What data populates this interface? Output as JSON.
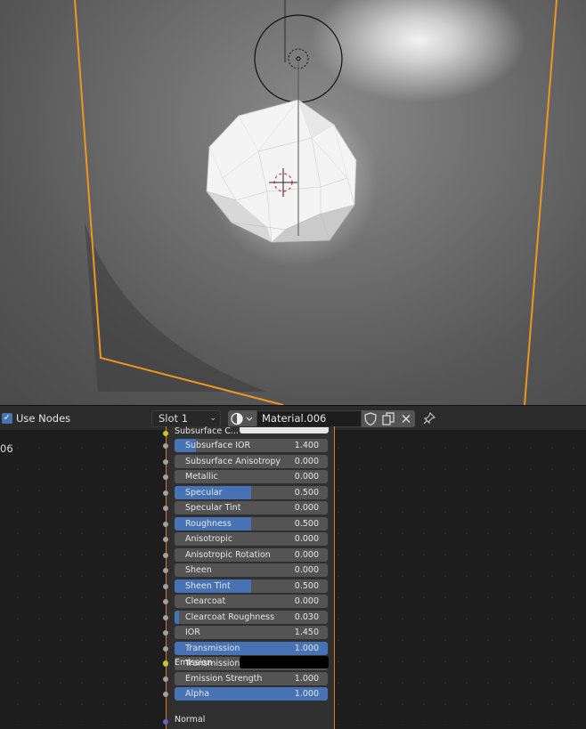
{
  "header": {
    "use_nodes_label": "Use Nodes",
    "slot_label": "Slot 1",
    "material_name": "Material.006"
  },
  "side_label": "06",
  "colors": {
    "accent_blue": "#4772b3",
    "field_grey": "#545454",
    "node_outline": "#e07b1c",
    "socket_grey": "#a1a1a1",
    "socket_yellow": "#c7c729"
  },
  "node": {
    "top_label": "Subsurface C...",
    "emission_label": "Emission",
    "normal_label": "Normal",
    "rows": [
      {
        "label": "Subsurface IOR",
        "value": "1.400",
        "fill": 0.14
      },
      {
        "label": "Subsurface Anisotropy",
        "value": "0.000",
        "fill": 0
      },
      {
        "label": "Metallic",
        "value": "0.000",
        "fill": 0
      },
      {
        "label": "Specular",
        "value": "0.500",
        "fill": 0.5
      },
      {
        "label": "Specular Tint",
        "value": "0.000",
        "fill": 0
      },
      {
        "label": "Roughness",
        "value": "0.500",
        "fill": 0.5
      },
      {
        "label": "Anisotropic",
        "value": "0.000",
        "fill": 0
      },
      {
        "label": "Anisotropic Rotation",
        "value": "0.000",
        "fill": 0
      },
      {
        "label": "Sheen",
        "value": "0.000",
        "fill": 0
      },
      {
        "label": "Sheen Tint",
        "value": "0.500",
        "fill": 0.5
      },
      {
        "label": "Clearcoat",
        "value": "0.000",
        "fill": 0
      },
      {
        "label": "Clearcoat Roughness",
        "value": "0.030",
        "fill": 0.03
      },
      {
        "label": "IOR",
        "value": "1.450",
        "fill": 0
      },
      {
        "label": "Transmission",
        "value": "1.000",
        "fill": 1
      },
      {
        "label": "Transmission Roughness",
        "value": "0.000",
        "fill": 0
      }
    ],
    "emission_strength": {
      "label": "Emission Strength",
      "value": "1.000",
      "fill": 0
    },
    "alpha": {
      "label": "Alpha",
      "value": "1.000",
      "fill": 1
    }
  }
}
